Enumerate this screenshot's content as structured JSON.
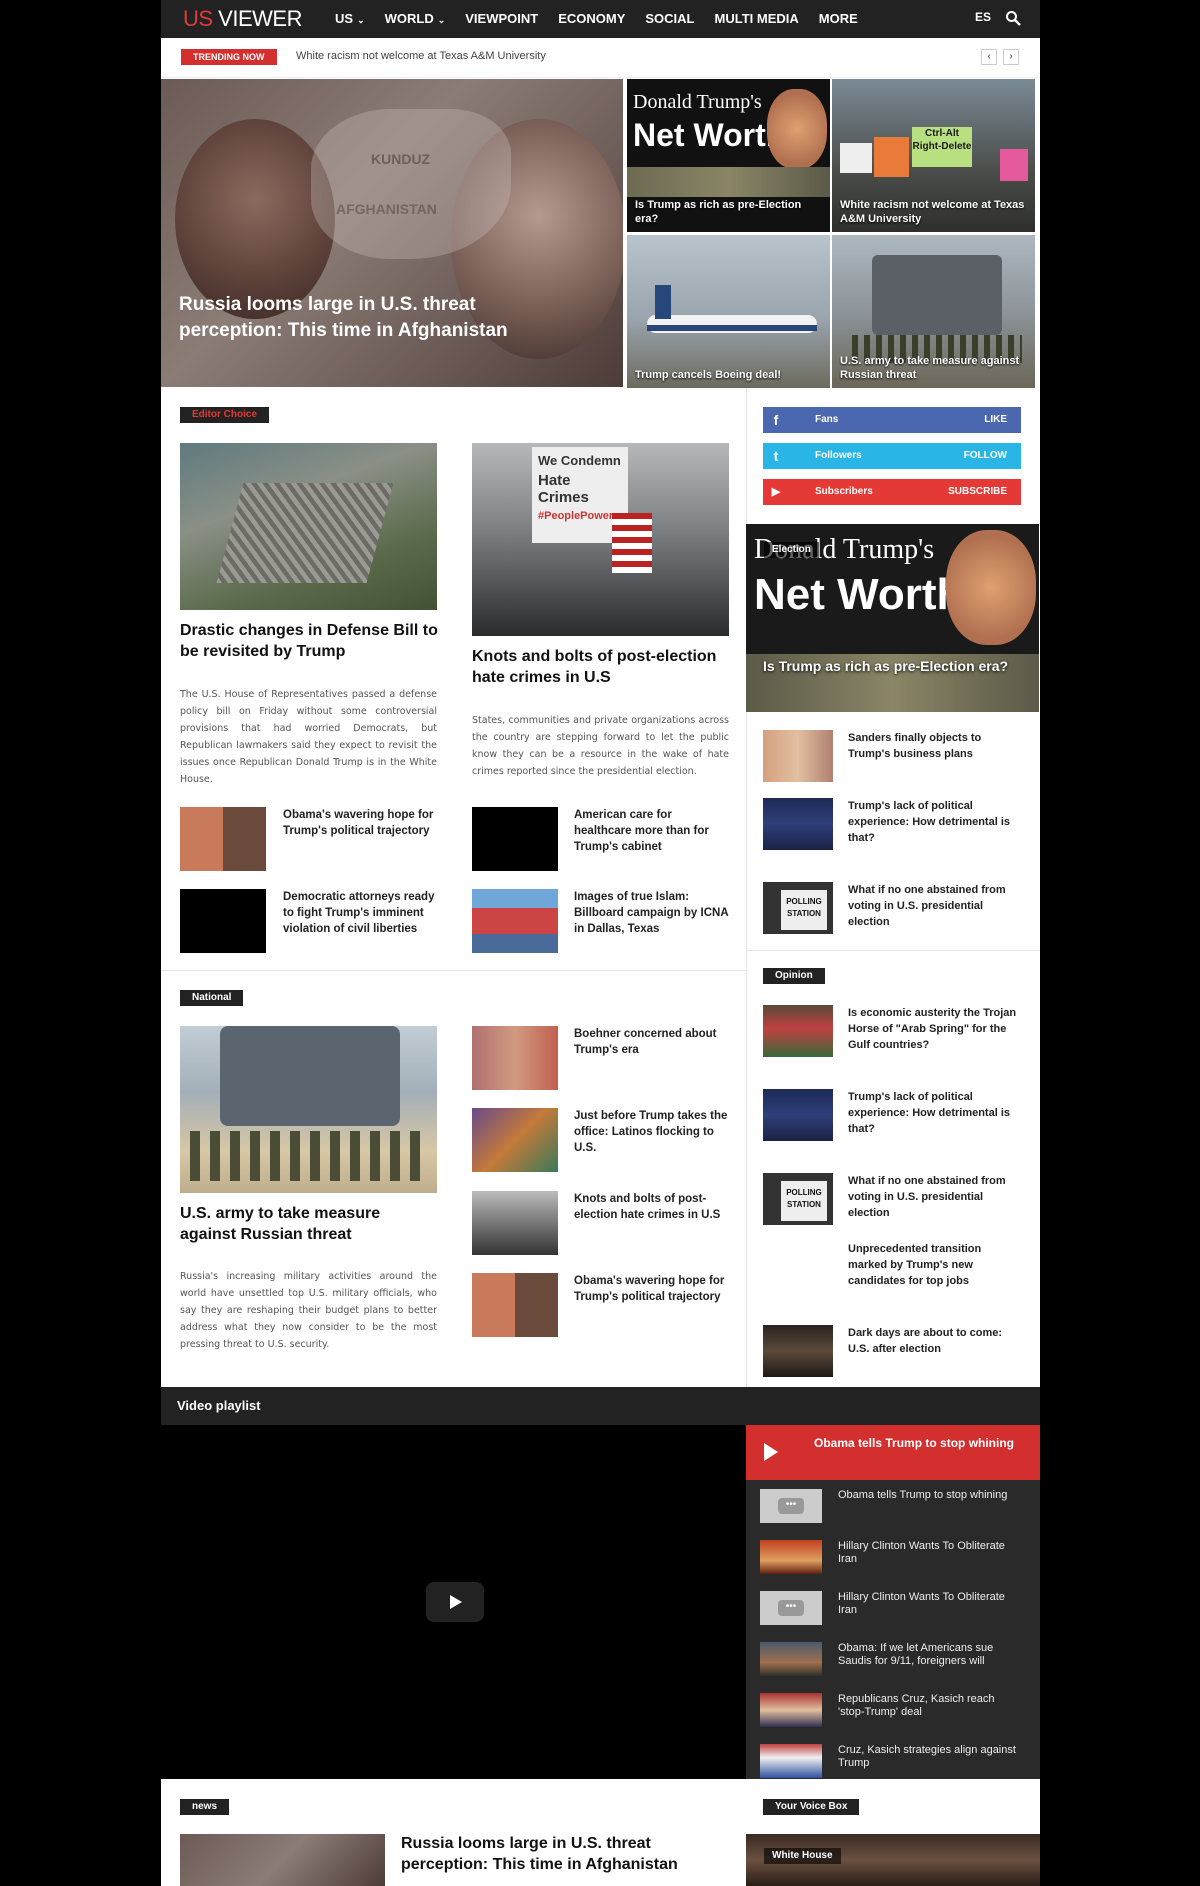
{
  "nav": {
    "logo_us": "US",
    "logo_viewer": " VIEWER",
    "items": [
      {
        "label": "US",
        "caret": "⌄"
      },
      {
        "label": "WORLD",
        "caret": "⌄"
      },
      {
        "label": "VIEWPOINT",
        "caret": ""
      },
      {
        "label": "ECONOMY",
        "caret": ""
      },
      {
        "label": "SOCIAL",
        "caret": ""
      },
      {
        "label": "MULTI MEDIA",
        "caret": ""
      },
      {
        "label": "MORE",
        "caret": ""
      }
    ],
    "lang": "ES"
  },
  "trending": {
    "badge": "TRENDING NOW",
    "text": "White racism not welcome at Texas A&M University",
    "prev": "‹",
    "next": "›"
  },
  "hero": {
    "main_title": "Russia looms large in U.S. threat perception: This time in Afghanistan",
    "main_overlay_1": "KUNDUZ",
    "main_overlay_2": "AFGHANISTAN",
    "tiles": [
      {
        "caption": "Is Trump as rich as pre-Election era?",
        "overlay_1": "Donald Trump's",
        "overlay_2": "Net Worth"
      },
      {
        "caption": "White racism not welcome at Texas A&M University",
        "sign_1": "Ctrl-Alt Right-Delete"
      },
      {
        "caption": "Trump cancels Boeing deal!"
      },
      {
        "caption": "U.S. army to take measure against Russian threat"
      }
    ]
  },
  "editor": {
    "badge": "Editor Choice",
    "left": {
      "title": "Drastic changes in Defense Bill to be revisited by Trump",
      "text": "The U.S. House of Representatives passed a defense policy bill on Friday without some controversial provisions that had worried Democrats, but Republican lawmakers said they expect to revisit the issues once Republican Donald Trump is in the White House."
    },
    "right": {
      "title": "Knots and bolts of post-election hate crimes in U.S",
      "text": "States, communities and private organizations across the country are stepping forward to let the public know they can be a resource in the wake of hate crimes reported since the presidential election.",
      "sign_1": "We Condemn",
      "sign_2": "Hate Crimes",
      "sign_3": "#PeoplePower"
    },
    "small": [
      {
        "title": "Obama's wavering hope for Trump's political trajectory"
      },
      {
        "title": "American care for healthcare more than for Trump's cabinet"
      },
      {
        "title": "Democratic attorneys ready to fight Trump's imminent violation of civil liberties"
      },
      {
        "title": "Images of true Islam: Billboard campaign by ICNA in Dallas, Texas"
      }
    ]
  },
  "national": {
    "badge": "National",
    "main": {
      "title": "U.S. army to take measure against Russian threat",
      "text": "Russia's increasing military activities around the world have unsettled top U.S. military officials, who say they are reshaping their budget plans to better address what they now consider to be the most pressing threat to U.S. security."
    },
    "list": [
      {
        "title": "Boehner concerned about Trump's era"
      },
      {
        "title": "Just before Trump takes the office: Latinos flocking to U.S."
      },
      {
        "title": "Knots and bolts of post-election hate crimes in U.S"
      },
      {
        "title": "Obama's wavering hope for Trump's political trajectory"
      }
    ]
  },
  "sidebar": {
    "social": [
      {
        "label": "Fans",
        "action": "LIKE",
        "icon": "f",
        "color": "#4a67b0"
      },
      {
        "label": "Followers",
        "action": "FOLLOW",
        "icon": "t",
        "color": "#29b6e6"
      },
      {
        "label": "Subscribers",
        "action": "SUBSCRIBE",
        "icon": "▶",
        "color": "#e53935"
      }
    ],
    "feature": {
      "tag": "Election",
      "title": "Is Trump as rich as pre-Election era?",
      "overlay_1": "Donald Trump's",
      "overlay_2": "Net Worth"
    },
    "items": [
      {
        "title": "Sanders finally objects to Trump's business plans"
      },
      {
        "title": "Trump's lack of political experience: How detrimental is that?"
      },
      {
        "title": "What if no one abstained from voting in U.S. presidential election",
        "sign": "POLLING STATION"
      }
    ],
    "opinion_badge": "Opinion",
    "opinion": [
      {
        "title": "Is economic austerity the Trojan Horse of \"Arab Spring\" for the Gulf countries?"
      },
      {
        "title": "Trump's lack of political experience: How detrimental is that?"
      },
      {
        "title": "What if no one abstained from voting in U.S. presidential election",
        "sign": "POLLING STATION"
      },
      {
        "title": "Unprecedented transition marked by Trump's new candidates for top jobs"
      },
      {
        "title": "Dark days are about to come: U.S. after election"
      }
    ]
  },
  "video": {
    "bar_title": "Video playlist",
    "now_playing": "Obama tells Trump to stop whining",
    "list": [
      {
        "title": "Obama tells Trump to stop whining",
        "icon": "ellipsis-icon"
      },
      {
        "title": "Hillary Clinton Wants To Obliterate Iran",
        "icon": ""
      },
      {
        "title": "Hillary Clinton Wants To Obliterate Iran",
        "icon": "ellipsis-icon"
      },
      {
        "title": "Obama: If we let Americans sue Saudis for 9/11, foreigners will",
        "icon": ""
      },
      {
        "title": "Republicans Cruz, Kasich reach 'stop-Trump' deal",
        "icon": ""
      },
      {
        "title": "Cruz, Kasich strategies align against Trump",
        "icon": ""
      }
    ],
    "colors": {
      "accent": "#d32f2f",
      "dark": "#222222"
    }
  },
  "bottom": {
    "news_badge": "news",
    "news_title": "Russia looms large in U.S. threat perception: This time in Afghanistan",
    "voice_badge": "Your Voice Box",
    "voice_tag": "White House"
  }
}
